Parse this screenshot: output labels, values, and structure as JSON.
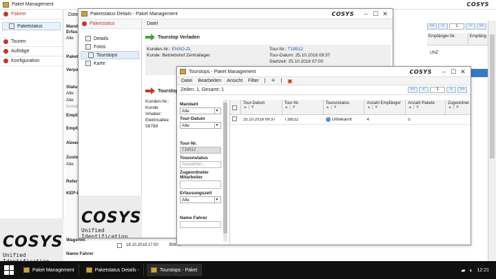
{
  "main_window": {
    "title": "Paket Management",
    "logo": "COSYS",
    "nav": [
      {
        "label": "Pakete",
        "active": true
      },
      {
        "label": "Paketstatus",
        "active": false,
        "sub": true
      },
      {
        "label": "Touren",
        "active": false
      },
      {
        "label": "Aufträge",
        "active": false
      },
      {
        "label": "Konfiguration",
        "active": false
      }
    ],
    "menu_file": "Datei",
    "filter_labels": [
      "Mandant",
      "Erfas",
      "Paket",
      "Verpa",
      "Status",
      "Empfä",
      "Empfä",
      "Absen",
      "Zuste",
      "Refer",
      "KEP-L",
      "Wagennr.",
      "Name Fahrer"
    ],
    "filter_values": [
      "Alle",
      "Alle",
      "Alle",
      "Auswah",
      "Alle"
    ],
    "col_headers": [
      "Empfänger-Nr.",
      "Empfäng"
    ],
    "right_cells": [
      "UNZ",
      "UNZ"
    ],
    "bottom_row": {
      "date": "18.10.2018 17:00",
      "ref": "BW4..."
    },
    "page": "1",
    "brand_tagline": "Unified Identification"
  },
  "status_window": {
    "title": "Paketstatus Details - Paket Management",
    "logo": "COSYS",
    "menu_file": "Datei",
    "nav_header": "Paketstatus",
    "nav": [
      {
        "label": "Details"
      },
      {
        "label": "Fotos"
      },
      {
        "label": "Tourstops",
        "active": true
      },
      {
        "label": "Karte"
      }
    ],
    "section_title": "Tourstop Verladen",
    "kunden_nr_label": "Kunden-Nr.:",
    "kunden_nr_value": "ENSO-ZL",
    "kunde_label": "Kunde:",
    "kunde_value": "Betriebshof Zentrallager",
    "tour_nr_label": "Tour-Nr.:",
    "tour_nr_value": "T18512",
    "tour_datum": "Tour-Datum: 25.10.2018 09:37",
    "startzeit": "Startzeit: 25.10.2018 07:00",
    "section2_title": "Tourstop",
    "section2_lines": [
      "Kunden-Nr.:",
      "Kunde",
      "Inhaber:",
      "Elektroallee",
      "56789"
    ],
    "brand_tagline": "Unified Identification"
  },
  "tourstops_window": {
    "title": "Tourstops - Paket Management",
    "logo": "COSYS",
    "menu": [
      "Datei",
      "Bearbeiten",
      "Ansicht",
      "Filter",
      "|"
    ],
    "summary": "Zeilen: 1, Gesamt: 1",
    "page": "1",
    "filters": {
      "mandant_label": "Mandant",
      "mandant_value": "Alle",
      "tourdatum_label": "Tour-Datum",
      "tourdatum_value": "Alle",
      "tournr_label": "Tour-Nr.",
      "tournr_value": "T18512",
      "tourenstatus_label": "Tourenstatus",
      "tourenstatus_placeholder": "Auswählen...",
      "mitarbeiter_label": "Zugeordneter Mitarbeiter",
      "erfassungszeit_label": "Erfassungszeit",
      "erfassungszeit_value": "Alle",
      "fahrer_label": "Name Fahrer"
    },
    "columns": [
      "Tour-Datum",
      "Tour-Nr.",
      "Tourenstatus",
      "Anzahl Empfänger",
      "Anzahl Pakete",
      "Zugeordnet"
    ],
    "rows": [
      {
        "date": "25.10.2018 09:37",
        "tour": "T18512",
        "status": "Unbekannt",
        "empf": "4",
        "pakete": "5",
        "zug": ""
      }
    ]
  },
  "taskbar": {
    "items": [
      "Paket Management",
      "Paketstatus Details -",
      "Tourstops - Paket"
    ],
    "time": "12:21"
  },
  "colors": {
    "accent_red": "#c0392b",
    "green_arrow": "#3fa535",
    "pager_blue": "#4a7ab5"
  }
}
